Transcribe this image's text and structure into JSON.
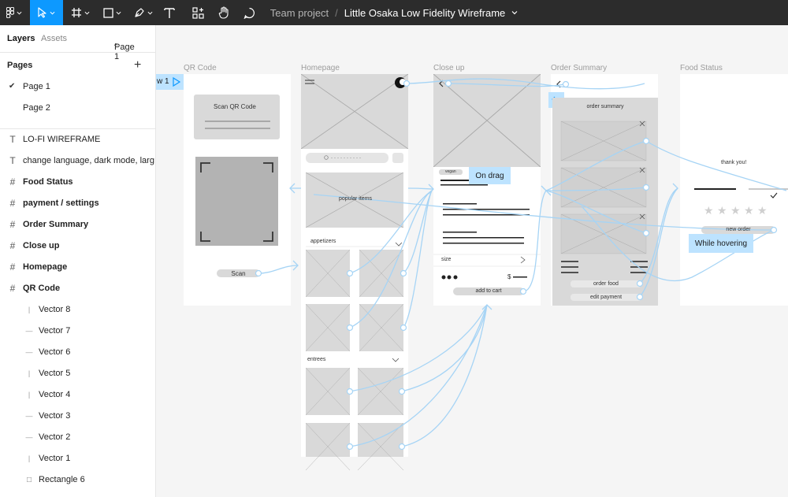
{
  "toolbar": {
    "team": "Team project",
    "separator": "/",
    "file_name": "Little Osaka Low Fidelity Wireframe"
  },
  "sidebar": {
    "tabs": {
      "layers": "Layers",
      "assets": "Assets",
      "page_selector": "Page 1"
    },
    "pages_heading": "Pages",
    "add_page": "+",
    "pages": [
      {
        "label": "Page 1",
        "selected": true
      },
      {
        "label": "Page 2",
        "selected": false
      }
    ],
    "layers": [
      {
        "label": "LO-FI WIREFRAME",
        "icon": "T"
      },
      {
        "label": "change language, dark mode, larg...",
        "icon": "T"
      },
      {
        "label": "Food Status",
        "icon": "#"
      },
      {
        "label": "payment / settings",
        "icon": "#"
      },
      {
        "label": "Order Summary",
        "icon": "#"
      },
      {
        "label": "Close up",
        "icon": "#"
      },
      {
        "label": "Homepage",
        "icon": "#"
      },
      {
        "label": "QR Code",
        "icon": "#"
      },
      {
        "label": "Vector 8",
        "icon": "|"
      },
      {
        "label": "Vector 7",
        "icon": "—"
      },
      {
        "label": "Vector 6",
        "icon": "—"
      },
      {
        "label": "Vector 5",
        "icon": "|"
      },
      {
        "label": "Vector 4",
        "icon": "|"
      },
      {
        "label": "Vector 3",
        "icon": "—"
      },
      {
        "label": "Vector 2",
        "icon": "—"
      },
      {
        "label": "Vector 1",
        "icon": "|"
      },
      {
        "label": "Rectangle 6",
        "icon": "□"
      }
    ]
  },
  "canvas": {
    "flow_label": "w 1",
    "frames": {
      "qr": "QR Code",
      "home": "Homepage",
      "closeup": "Close up",
      "order": "Order Summary",
      "status": "Food Status"
    },
    "qr": {
      "title": "Scan QR Code",
      "scan_button": "Scan"
    },
    "home": {
      "popular": "popular items",
      "appetizers": "appetizers",
      "entrees": "entrees"
    },
    "closeup": {
      "tag": "vegan",
      "size": "size",
      "price_sign": "$",
      "add_to_cart": "add to cart"
    },
    "order": {
      "title": "order summary",
      "order_food": "order food",
      "edit_payment": "edit payment"
    },
    "status": {
      "thank_you": "thank you!",
      "new_order": "new order"
    },
    "callouts": {
      "drag": "On drag",
      "hover": "While hovering"
    }
  },
  "colors": {
    "accent": "#0d99ff",
    "toolbar_bg": "#2c2c2c",
    "prototype_line": "#a6d4f5",
    "callout_bg": "#bde3ff"
  }
}
